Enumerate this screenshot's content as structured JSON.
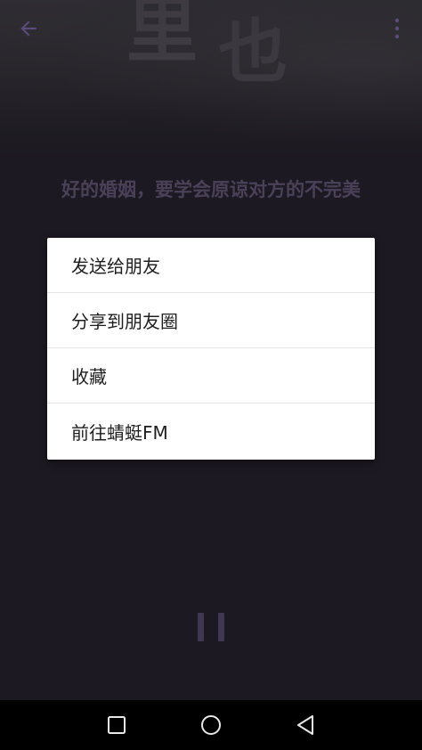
{
  "player": {
    "cover_text_1": "里",
    "cover_text_2": "也",
    "song_title": "好的婚姻，要学会原谅对方的不完美"
  },
  "icons": {
    "back": "arrow-back-icon",
    "more": "more-vertical-icon",
    "pause": "pause-icon"
  },
  "share_menu": {
    "items": [
      {
        "label": "发送给朋友"
      },
      {
        "label": "分享到朋友圈"
      },
      {
        "label": "收藏"
      },
      {
        "label": "前往蜻蜓FM"
      }
    ]
  },
  "system_nav": {
    "buttons": [
      "recent-apps-icon",
      "home-icon",
      "back-triangle-icon"
    ]
  },
  "colors": {
    "accent": "#5b4a7a",
    "title_text": "#4a4158",
    "menu_bg": "#ffffff"
  }
}
